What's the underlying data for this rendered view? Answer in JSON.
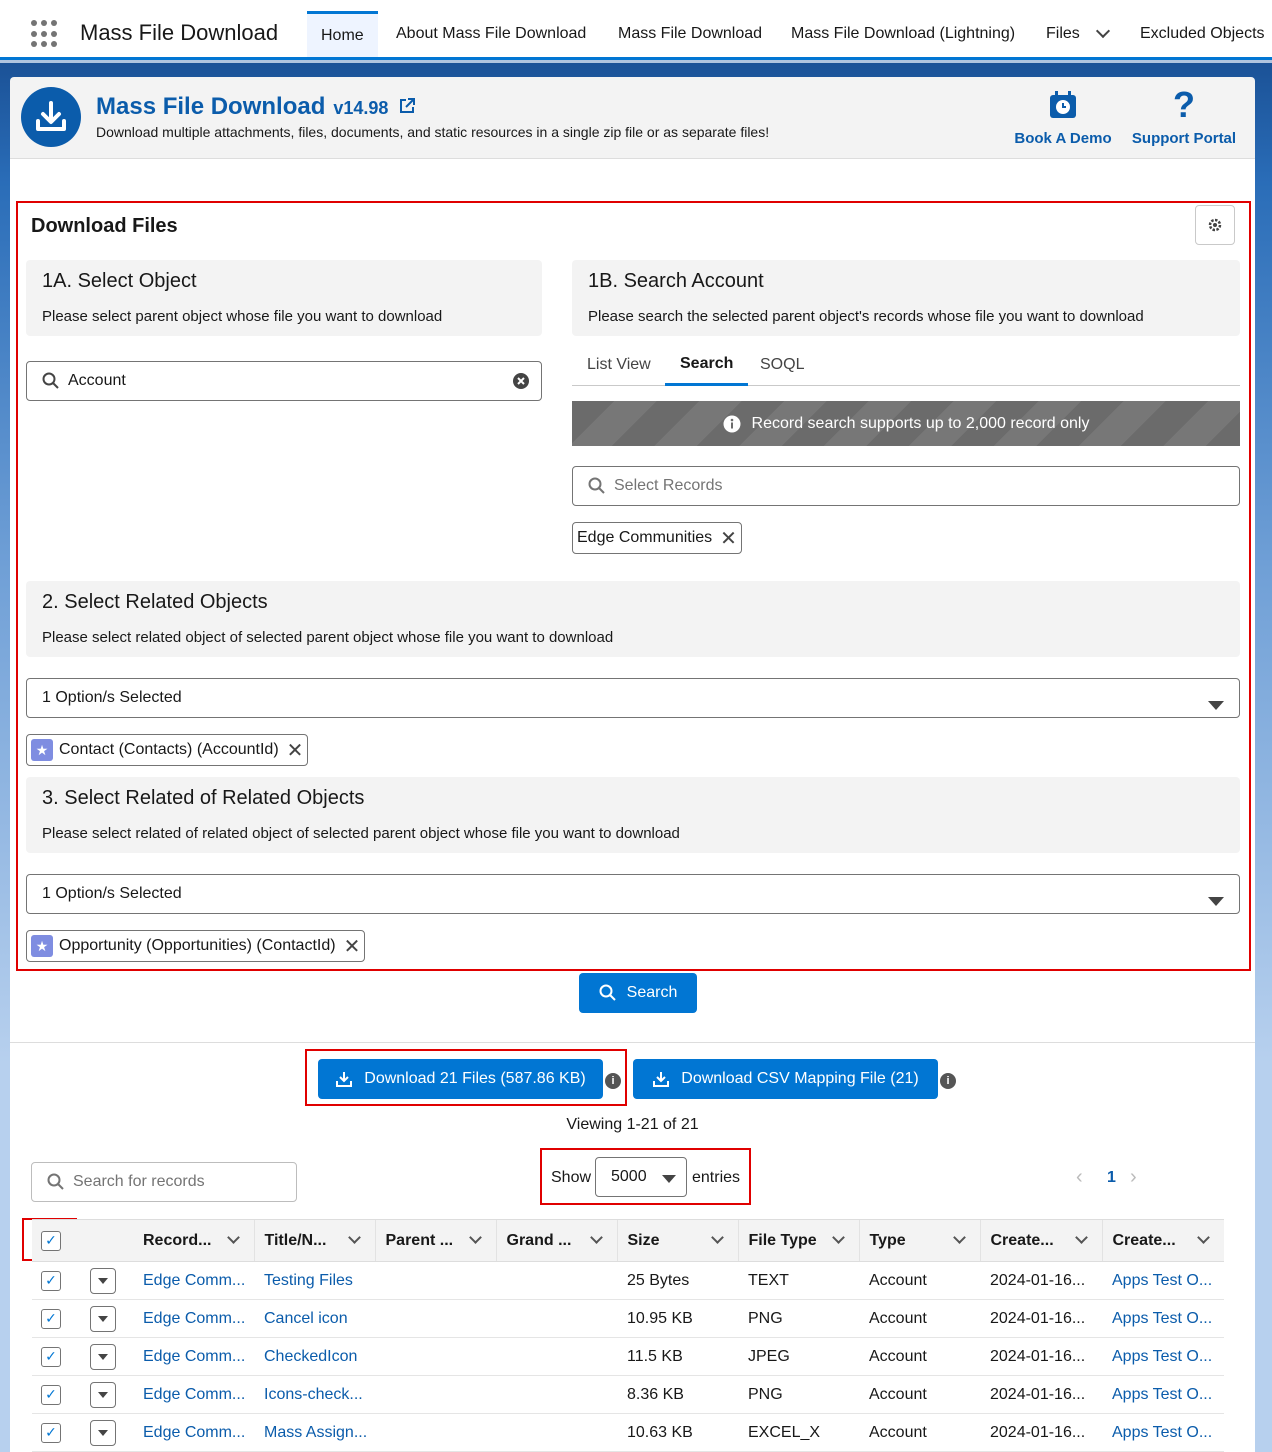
{
  "nav": {
    "app_name": "Mass File Download",
    "tabs": [
      "Home",
      "About Mass File Download",
      "Mass File Download",
      "Mass File Download (Lightning)",
      "Files",
      "Excluded Objects"
    ],
    "active_tab": "Home"
  },
  "header": {
    "title": "Mass File Download",
    "version": "v14.98",
    "subtitle": "Download multiple attachments, files, documents, and static resources in a single zip file or as separate files!",
    "book_demo": "Book A Demo",
    "support": "Support Portal"
  },
  "download_files": {
    "title": "Download Files",
    "step1a": {
      "title": "1A. Select Object",
      "desc": "Please select parent object whose file you want to download",
      "value": "Account"
    },
    "step1b": {
      "title": "1B. Search Account",
      "desc": "Please search the selected parent object's records whose file you want to download",
      "tabs": [
        "List View",
        "Search",
        "SOQL"
      ],
      "active_tab": "Search",
      "banner": "Record search supports up to 2,000 record only",
      "placeholder": "Select Records",
      "pill": "Edge Communities"
    },
    "step2": {
      "title": "2. Select Related Objects",
      "desc": "Please select related object of selected parent object whose file you want to download",
      "selected": "1 Option/s Selected",
      "pill": "Contact (Contacts) (AccountId)"
    },
    "step3": {
      "title": "3. Select Related of Related Objects",
      "desc": "Please select related of related object of selected parent object whose file you want to download",
      "selected": "1 Option/s Selected",
      "pill": "Opportunity (Opportunities) (ContactId)"
    },
    "search_button": "Search"
  },
  "results": {
    "download_button": "Download 21 Files (587.86 KB)",
    "csv_button": "Download CSV Mapping File (21)",
    "viewing": "Viewing 1-21 of 21",
    "search_placeholder": "Search for records",
    "show_label": "Show",
    "show_value": "5000",
    "entries_label": "entries",
    "page": "1",
    "columns": [
      "Record...",
      "Title/N...",
      "Parent ...",
      "Grand ...",
      "Size",
      "File Type",
      "Type",
      "Create...",
      "Create..."
    ],
    "rows": [
      [
        "Edge Comm...",
        "Testing Files",
        "",
        "",
        "25 Bytes",
        "TEXT",
        "Account",
        "2024-01-16...",
        "Apps Test O..."
      ],
      [
        "Edge Comm...",
        "Cancel icon",
        "",
        "",
        "10.95 KB",
        "PNG",
        "Account",
        "2024-01-16...",
        "Apps Test O..."
      ],
      [
        "Edge Comm...",
        "CheckedIcon",
        "",
        "",
        "11.5 KB",
        "JPEG",
        "Account",
        "2024-01-16...",
        "Apps Test O..."
      ],
      [
        "Edge Comm...",
        "Icons-check...",
        "",
        "",
        "8.36 KB",
        "PNG",
        "Account",
        "2024-01-16...",
        "Apps Test O..."
      ],
      [
        "Edge Comm...",
        "Mass Assign...",
        "",
        "",
        "10.63 KB",
        "EXCEL_X",
        "Account",
        "2024-01-16...",
        "Apps Test O..."
      ]
    ]
  },
  "colors": {
    "brand": "#0176d3",
    "title": "#0b5cab",
    "highlight": "#e00000"
  }
}
